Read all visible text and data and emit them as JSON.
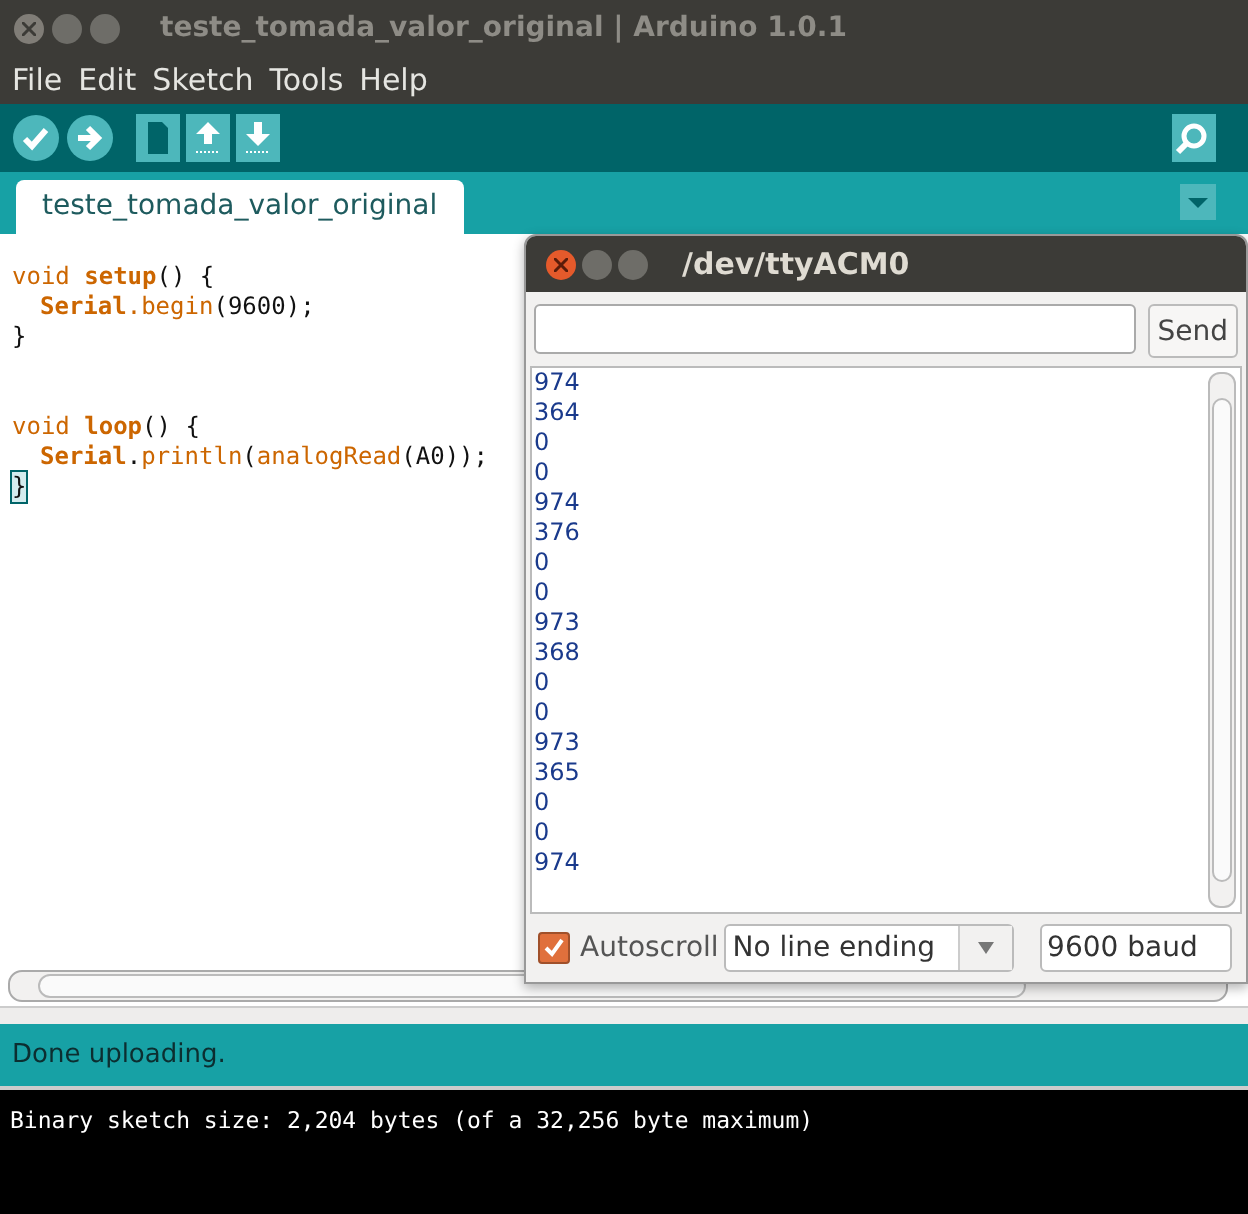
{
  "window": {
    "title": "teste_tomada_valor_original | Arduino 1.0.1"
  },
  "menu": [
    "File",
    "Edit",
    "Sketch",
    "Tools",
    "Help"
  ],
  "tabs": [
    {
      "label": "teste_tomada_valor_original",
      "selected": true
    }
  ],
  "code": {
    "blocks": [
      [
        {
          "indent": false,
          "tokens": [
            {
              "text": "void",
              "kind": "keyword"
            },
            {
              "text": "setup",
              "kind": "function"
            },
            {
              "text": "() {",
              "kind": "plain"
            }
          ]
        },
        {
          "indent": true,
          "tokens": [
            {
              "text": "Serial",
              "kind": "class"
            },
            {
              "text": ".begin",
              "kind": "method"
            },
            {
              "text": "(9600);",
              "kind": "plain"
            }
          ]
        },
        {
          "indent": false,
          "tokens": [
            {
              "text": "}",
              "kind": "plain"
            }
          ]
        }
      ],
      [
        {
          "indent": false,
          "tokens": [
            {
              "text": "void",
              "kind": "keyword"
            },
            {
              "text": "loop",
              "kind": "function"
            },
            {
              "text": "() {",
              "kind": "plain"
            }
          ]
        },
        {
          "indent": true,
          "tokens": [
            {
              "text": "Serial",
              "kind": "class"
            },
            {
              "text": ".",
              "kind": "plain"
            },
            {
              "text": "println",
              "kind": "method"
            },
            {
              "text": "(",
              "kind": "plain"
            },
            {
              "text": "analogRead",
              "kind": "method"
            },
            {
              "text": "(A0));",
              "kind": "plain"
            }
          ]
        },
        {
          "indent": false,
          "tokens": [
            {
              "text": "}",
              "kind": "caret"
            }
          ]
        }
      ]
    ]
  },
  "status": "Done uploading.",
  "console": "Binary sketch size: 2,204 bytes (of a 32,256 byte maximum)",
  "serial_monitor": {
    "title": "/dev/ttyACM0",
    "send_button": "Send",
    "output": [
      "974",
      "364",
      "0",
      "0",
      "974",
      "376",
      "0",
      "0",
      "973",
      "368",
      "0",
      "0",
      "973",
      "365",
      "0",
      "0",
      "974"
    ],
    "autoscroll": {
      "label": "Autoscroll",
      "checked": true
    },
    "line_ending": "No line ending",
    "baud": "9600 baud"
  }
}
